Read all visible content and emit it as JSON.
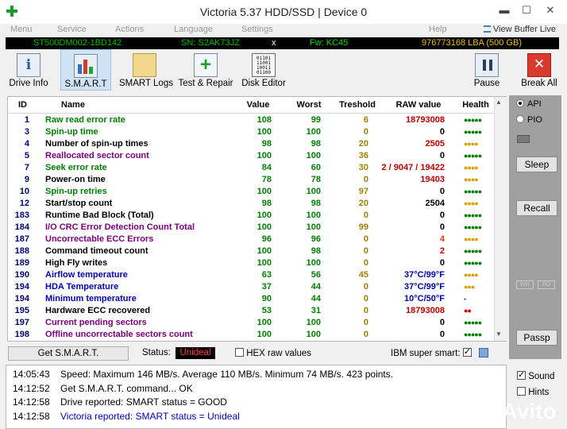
{
  "window": {
    "title": "Victoria 5.37 HDD/SSD | Device 0"
  },
  "menu": [
    "Menu",
    "Service",
    "Actions",
    "Language",
    "Settings",
    "Help"
  ],
  "view_buffer_live": "View Buffer Live",
  "device": {
    "model": "ST500DM002-1BD142",
    "sn": "SN: S2AK73JZ",
    "close": "x",
    "fw": "Fw: KC45",
    "lba": "976773168 LBA (500 GB)"
  },
  "toolbar": {
    "drive_info": "Drive Info",
    "smart": "S.M.A.R.T",
    "smart_logs": "SMART Logs",
    "test_repair": "Test & Repair",
    "disk_editor": "Disk Editor",
    "pause": "Pause",
    "break_all": "Break All"
  },
  "disk_editor_icon_text": "01101\n11001\n10011\n01100",
  "table": {
    "headers": [
      "ID",
      "Name",
      "Value",
      "Worst",
      "Treshold",
      "RAW value",
      "Health"
    ],
    "rows": [
      {
        "id": "1",
        "name": "Raw read error rate",
        "value": "108",
        "worst": "99",
        "thr": "6",
        "raw": "18793008",
        "health": "●●●●●",
        "nc": "#008000",
        "rc": "#c00000",
        "hc": "#008000"
      },
      {
        "id": "3",
        "name": "Spin-up time",
        "value": "100",
        "worst": "100",
        "thr": "0",
        "raw": "0",
        "health": "●●●●●",
        "nc": "#008000",
        "rc": "#000000",
        "hc": "#008000"
      },
      {
        "id": "4",
        "name": "Number of spin-up times",
        "value": "98",
        "worst": "98",
        "thr": "20",
        "raw": "2505",
        "health": "●●●●",
        "nc": "#000000",
        "rc": "#c00000",
        "hc": "#e0a000"
      },
      {
        "id": "5",
        "name": "Reallocated sector count",
        "value": "100",
        "worst": "100",
        "thr": "36",
        "raw": "0",
        "health": "●●●●●",
        "nc": "#800080",
        "rc": "#000000",
        "hc": "#008000"
      },
      {
        "id": "7",
        "name": "Seek error rate",
        "value": "84",
        "worst": "60",
        "thr": "30",
        "raw": "2 / 9047 / 19422",
        "health": "●●●●",
        "nc": "#008000",
        "rc": "#c00000",
        "hc": "#e0a000"
      },
      {
        "id": "9",
        "name": "Power-on time",
        "value": "78",
        "worst": "78",
        "thr": "0",
        "raw": "19403",
        "health": "●●●●",
        "nc": "#000000",
        "rc": "#c00000",
        "hc": "#e0a000"
      },
      {
        "id": "10",
        "name": "Spin-up retries",
        "value": "100",
        "worst": "100",
        "thr": "97",
        "raw": "0",
        "health": "●●●●●",
        "nc": "#008000",
        "rc": "#000000",
        "hc": "#008000"
      },
      {
        "id": "12",
        "name": "Start/stop count",
        "value": "98",
        "worst": "98",
        "thr": "20",
        "raw": "2504",
        "health": "●●●●",
        "nc": "#000000",
        "rc": "#000000",
        "hc": "#e0a000"
      },
      {
        "id": "183",
        "name": "Runtime Bad Block (Total)",
        "value": "100",
        "worst": "100",
        "thr": "0",
        "raw": "0",
        "health": "●●●●●",
        "nc": "#000000",
        "rc": "#000000",
        "hc": "#008000"
      },
      {
        "id": "184",
        "name": "I/O CRC Error Detection Count Total",
        "value": "100",
        "worst": "100",
        "thr": "99",
        "raw": "0",
        "health": "●●●●●",
        "nc": "#800080",
        "rc": "#000000",
        "hc": "#008000"
      },
      {
        "id": "187",
        "name": "Uncorrectable ECC Errors",
        "value": "96",
        "worst": "96",
        "thr": "0",
        "raw": "4",
        "health": "●●●●",
        "nc": "#800080",
        "rc": "#e04000",
        "hc": "#e0a000"
      },
      {
        "id": "188",
        "name": "Command timeout count",
        "value": "100",
        "worst": "98",
        "thr": "0",
        "raw": "2",
        "health": "●●●●●",
        "nc": "#000000",
        "rc": "#c00000",
        "hc": "#008000"
      },
      {
        "id": "189",
        "name": "High Fly writes",
        "value": "100",
        "worst": "100",
        "thr": "0",
        "raw": "0",
        "health": "●●●●●",
        "nc": "#000000",
        "rc": "#000000",
        "hc": "#008000"
      },
      {
        "id": "190",
        "name": "Airflow temperature",
        "value": "63",
        "worst": "56",
        "thr": "45",
        "raw": "37°C/99°F",
        "health": "●●●●",
        "nc": "#0000c0",
        "rc": "#0000c0",
        "hc": "#e0a000"
      },
      {
        "id": "194",
        "name": "HDA Temperature",
        "value": "37",
        "worst": "44",
        "thr": "0",
        "raw": "37°C/99°F",
        "health": "●●●",
        "nc": "#0000c0",
        "rc": "#0000c0",
        "hc": "#e0a000"
      },
      {
        "id": "194",
        "name": "Minimum temperature",
        "value": "90",
        "worst": "44",
        "thr": "0",
        "raw": "10°C/50°F",
        "health": "-",
        "nc": "#0000c0",
        "rc": "#0000c0",
        "hc": "#000000"
      },
      {
        "id": "195",
        "name": "Hardware ECC recovered",
        "value": "53",
        "worst": "31",
        "thr": "0",
        "raw": "18793008",
        "health": "●●",
        "nc": "#000000",
        "rc": "#c00000",
        "hc": "#d00000"
      },
      {
        "id": "197",
        "name": "Current pending sectors",
        "value": "100",
        "worst": "100",
        "thr": "0",
        "raw": "0",
        "health": "●●●●●",
        "nc": "#800080",
        "rc": "#000000",
        "hc": "#008000"
      },
      {
        "id": "198",
        "name": "Offline uncorrectable sectors count",
        "value": "100",
        "worst": "100",
        "thr": "0",
        "raw": "0",
        "health": "●●●●●",
        "nc": "#800080",
        "rc": "#000000",
        "hc": "#008000"
      }
    ]
  },
  "panel": {
    "api": "API",
    "pio": "PIO",
    "sleep": "Sleep",
    "recall": "Recall",
    "passp": "Passp",
    "mini1": "WR",
    "mini2": "RD"
  },
  "bottom": {
    "get_smart": "Get S.M.A.R.T.",
    "status_label": "Status:",
    "status_value": "Unideal",
    "hex_raw": "HEX raw values",
    "ibm": "IBM super smart:"
  },
  "log": [
    {
      "time": "14:05:43",
      "text": "Speed: Maximum 146 MB/s. Average 110 MB/s. Minimum 74 MB/s. 423 points.",
      "color": "#000000"
    },
    {
      "time": "14:12:52",
      "text": "Get S.M.A.R.T. command... OK",
      "color": "#000000"
    },
    {
      "time": "14:12:58",
      "text": "Drive reported: SMART status = GOOD",
      "color": "#000000"
    },
    {
      "time": "14:12:58",
      "text": "Victoria reported: SMART status = Unideal",
      "color": "#0000c0"
    }
  ],
  "options": {
    "sound": "Sound",
    "hints": "Hints"
  },
  "watermark": "Avito"
}
